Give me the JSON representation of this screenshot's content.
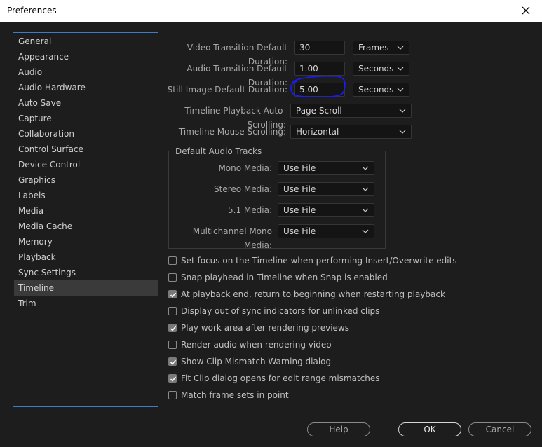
{
  "window": {
    "title": "Preferences",
    "close_icon": "close-icon"
  },
  "sidebar": {
    "items": [
      {
        "label": "General"
      },
      {
        "label": "Appearance"
      },
      {
        "label": "Audio"
      },
      {
        "label": "Audio Hardware"
      },
      {
        "label": "Auto Save"
      },
      {
        "label": "Capture"
      },
      {
        "label": "Collaboration"
      },
      {
        "label": "Control Surface"
      },
      {
        "label": "Device Control"
      },
      {
        "label": "Graphics"
      },
      {
        "label": "Labels"
      },
      {
        "label": "Media"
      },
      {
        "label": "Media Cache"
      },
      {
        "label": "Memory"
      },
      {
        "label": "Playback"
      },
      {
        "label": "Sync Settings"
      },
      {
        "label": "Timeline"
      },
      {
        "label": "Trim"
      }
    ],
    "selected": "Timeline"
  },
  "fields": {
    "video_transition": {
      "label": "Video Transition Default Duration:",
      "value": "30",
      "unit": "Frames"
    },
    "audio_transition": {
      "label": "Audio Transition Default Duration:",
      "value": "1.00",
      "unit": "Seconds"
    },
    "still_image": {
      "label": "Still Image Default Duration:",
      "value": "5.00",
      "unit": "Seconds"
    },
    "auto_scrolling": {
      "label": "Timeline Playback Auto-Scrolling:",
      "value": "Page Scroll"
    },
    "mouse_scrolling": {
      "label": "Timeline Mouse Scrolling:",
      "value": "Horizontal"
    }
  },
  "audio_tracks": {
    "title": "Default Audio Tracks",
    "mono": {
      "label": "Mono Media:",
      "value": "Use File"
    },
    "stereo": {
      "label": "Stereo Media:",
      "value": "Use File"
    },
    "surround": {
      "label": "5.1 Media:",
      "value": "Use File"
    },
    "multichannel": {
      "label": "Multichannel Mono Media:",
      "value": "Use File"
    }
  },
  "checkboxes": [
    {
      "label": "Set focus on the Timeline when performing Insert/Overwrite edits",
      "checked": false
    },
    {
      "label": "Snap playhead in Timeline when Snap is enabled",
      "checked": false
    },
    {
      "label": "At playback end, return to beginning when restarting playback",
      "checked": true
    },
    {
      "label": "Display out of sync indicators for unlinked clips",
      "checked": false
    },
    {
      "label": "Play work area after rendering previews",
      "checked": true
    },
    {
      "label": "Render audio when rendering video",
      "checked": false
    },
    {
      "label": "Show Clip Mismatch Warning dialog",
      "checked": true
    },
    {
      "label": "Fit Clip dialog opens for edit range mismatches",
      "checked": true
    },
    {
      "label": "Match frame sets in point",
      "checked": false
    }
  ],
  "buttons": {
    "help": "Help",
    "ok": "OK",
    "cancel": "Cancel"
  },
  "colors": {
    "accent": "#3d7cc9",
    "annotation": "#1a1aff"
  }
}
